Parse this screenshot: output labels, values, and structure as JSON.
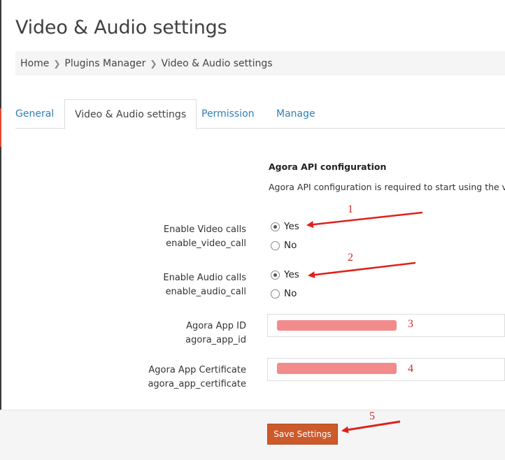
{
  "page": {
    "title": "Video & Audio settings"
  },
  "breadcrumb": {
    "items": [
      "Home",
      "Plugins Manager",
      "Video & Audio settings"
    ]
  },
  "tabs": [
    {
      "label": "General",
      "active": false
    },
    {
      "label": "Video & Audio settings",
      "active": true
    },
    {
      "label": "Permission",
      "active": false
    },
    {
      "label": "Manage",
      "active": false
    }
  ],
  "section": {
    "title": "Agora API configuration",
    "description": "Agora API configuration is required to start using the vid"
  },
  "fields": {
    "video": {
      "label": "Enable Video calls",
      "key": "enable_video_call",
      "options": [
        "Yes",
        "No"
      ],
      "selected": "Yes"
    },
    "audio": {
      "label": "Enable Audio calls",
      "key": "enable_audio_call",
      "options": [
        "Yes",
        "No"
      ],
      "selected": "Yes"
    },
    "app_id": {
      "label": "Agora App ID",
      "key": "agora_app_id",
      "value": ""
    },
    "app_cert": {
      "label": "Agora App Certificate",
      "key": "agora_app_certificate",
      "value": ""
    }
  },
  "footer": {
    "save_label": "Save Settings"
  },
  "annotations": [
    "1",
    "2",
    "3",
    "4",
    "5"
  ],
  "colors": {
    "accent": "#cd5a2a",
    "link": "#2f7fb5",
    "annotation": "#d42b2b",
    "redaction": "#f28b8b"
  }
}
